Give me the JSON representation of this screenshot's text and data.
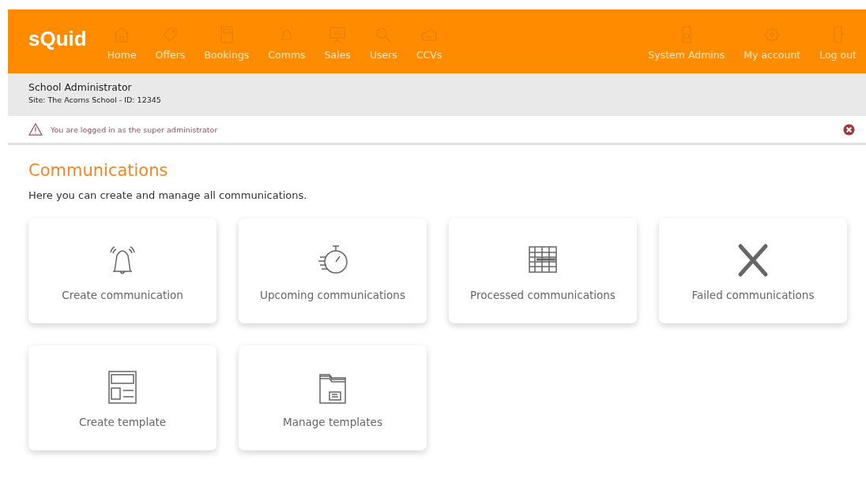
{
  "header": {
    "logo": "sQuid",
    "nav_left": [
      {
        "label": "Home",
        "kind": "home"
      },
      {
        "label": "Offers",
        "kind": "tag"
      },
      {
        "label": "Bookings",
        "kind": "book"
      },
      {
        "label": "Comms",
        "kind": "bell"
      },
      {
        "label": "Sales",
        "kind": "board"
      },
      {
        "label": "Users",
        "kind": "search"
      },
      {
        "label": "CCVs",
        "kind": "ticket"
      }
    ],
    "nav_right": [
      {
        "label": "System Admins",
        "kind": "phone"
      },
      {
        "label": "My account",
        "kind": "gear"
      },
      {
        "label": "Log out",
        "kind": "door"
      }
    ]
  },
  "user_bar": {
    "name": "School Administrator",
    "site": "Site: The Acorns School - ID:  12345"
  },
  "alert": {
    "message": "You are logged in as the super administrator"
  },
  "page": {
    "title": "Communications",
    "subtitle": "Here you can create and manage all communications."
  },
  "cards": [
    {
      "label": "Create communication",
      "kind": "bell"
    },
    {
      "label": "Upcoming communications",
      "kind": "stopwatch"
    },
    {
      "label": "Processed communications",
      "kind": "grid"
    },
    {
      "label": "Failed communications",
      "kind": "cross"
    },
    {
      "label": "Create template",
      "kind": "layout"
    },
    {
      "label": "Manage templates",
      "kind": "folder"
    }
  ]
}
